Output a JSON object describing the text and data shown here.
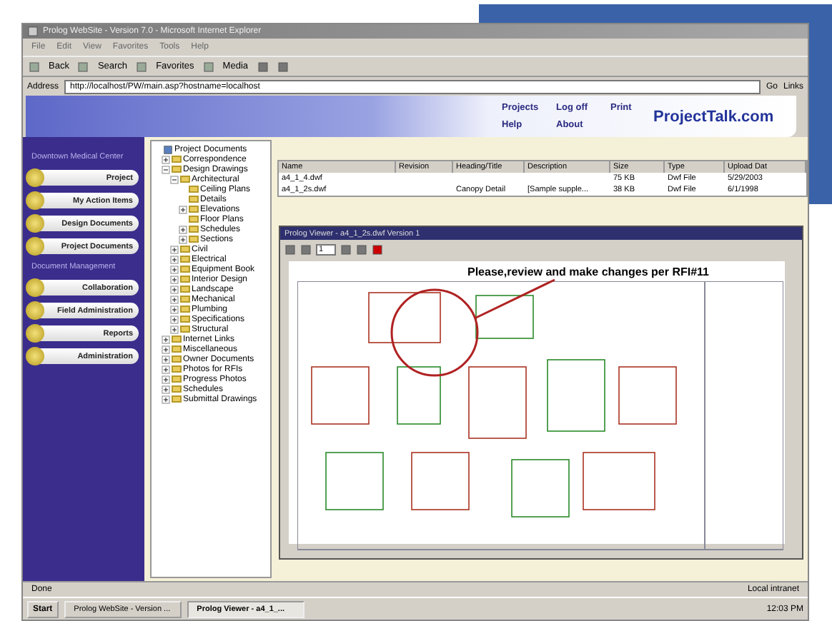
{
  "browser": {
    "title": "Prolog WebSite - Version 7.0 - Microsoft Internet Explorer",
    "menu": [
      "File",
      "Edit",
      "View",
      "Favorites",
      "Tools",
      "Help"
    ],
    "toolbar": [
      "Back",
      "Search",
      "Favorites",
      "Media"
    ],
    "address_label": "Address",
    "url": "http://localhost/PW/main.asp?hostname=localhost",
    "go": "Go",
    "links": "Links"
  },
  "header": {
    "links": [
      "Projects",
      "Log off",
      "Print",
      "Help",
      "About"
    ],
    "logo": "ProjectTalk.com"
  },
  "sidebar": {
    "project": "Downtown Medical Center",
    "items": [
      {
        "kind": "button",
        "label": "Project"
      },
      {
        "kind": "button",
        "label": "My Action Items"
      },
      {
        "kind": "button",
        "label": "Design Documents"
      },
      {
        "kind": "button",
        "label": "Project Documents"
      },
      {
        "kind": "heading",
        "label": "Document Management"
      },
      {
        "kind": "button",
        "label": "Collaboration"
      },
      {
        "kind": "button",
        "label": "Field Administration"
      },
      {
        "kind": "button",
        "label": "Reports"
      },
      {
        "kind": "button",
        "label": "Administration"
      }
    ]
  },
  "tree": [
    {
      "label": "Project Documents",
      "kind": "root",
      "children": [
        {
          "label": "Correspondence",
          "expanded": false
        },
        {
          "label": "Design Drawings",
          "expanded": true,
          "children": [
            {
              "label": "Architectural",
              "expanded": true,
              "children": [
                {
                  "label": "Ceiling Plans"
                },
                {
                  "label": "Details"
                },
                {
                  "label": "Elevations",
                  "expanded": false
                },
                {
                  "label": "Floor Plans"
                },
                {
                  "label": "Schedules",
                  "expanded": false
                },
                {
                  "label": "Sections",
                  "expanded": false
                }
              ]
            },
            {
              "label": "Civil",
              "expanded": false
            },
            {
              "label": "Electrical",
              "expanded": false
            },
            {
              "label": "Equipment Book",
              "expanded": false
            },
            {
              "label": "Interior Design",
              "expanded": false
            },
            {
              "label": "Landscape",
              "expanded": false
            },
            {
              "label": "Mechanical",
              "expanded": false
            },
            {
              "label": "Plumbing",
              "expanded": false
            },
            {
              "label": "Specifications",
              "expanded": false
            },
            {
              "label": "Structural",
              "expanded": false
            }
          ]
        },
        {
          "label": "Internet Links",
          "expanded": false
        },
        {
          "label": "Miscellaneous",
          "expanded": false
        },
        {
          "label": "Owner Documents",
          "expanded": false
        },
        {
          "label": "Photos for RFIs",
          "expanded": false
        },
        {
          "label": "Progress Photos",
          "expanded": false
        },
        {
          "label": "Schedules",
          "expanded": false
        },
        {
          "label": "Submittal Drawings",
          "expanded": false
        }
      ]
    }
  ],
  "table": {
    "columns": [
      "Name",
      "Revision",
      "Heading/Title",
      "Description",
      "Size",
      "Type",
      "Upload Dat"
    ],
    "rows": [
      [
        "a4_1_4.dwf",
        "",
        "",
        "",
        "75 KB",
        "Dwf File",
        "5/29/2003"
      ],
      [
        "a4_1_2s.dwf",
        "",
        "Canopy Detail",
        "[Sample supple...",
        "38 KB",
        "Dwf File",
        "6/1/1998"
      ]
    ]
  },
  "viewer": {
    "title": "Prolog Viewer - a4_1_2s.dwf  Version 1",
    "page": "1",
    "markup": "Please,review and make changes per RFI#11"
  },
  "status_bar": {
    "text": "Done",
    "zone": "Local intranet"
  },
  "taskbar": {
    "start": "Start",
    "tasks": [
      {
        "label": "Prolog WebSite - Version ...",
        "selected": false
      },
      {
        "label": "Prolog Viewer - a4_1_...",
        "selected": true
      }
    ],
    "time": "12:03 PM"
  }
}
